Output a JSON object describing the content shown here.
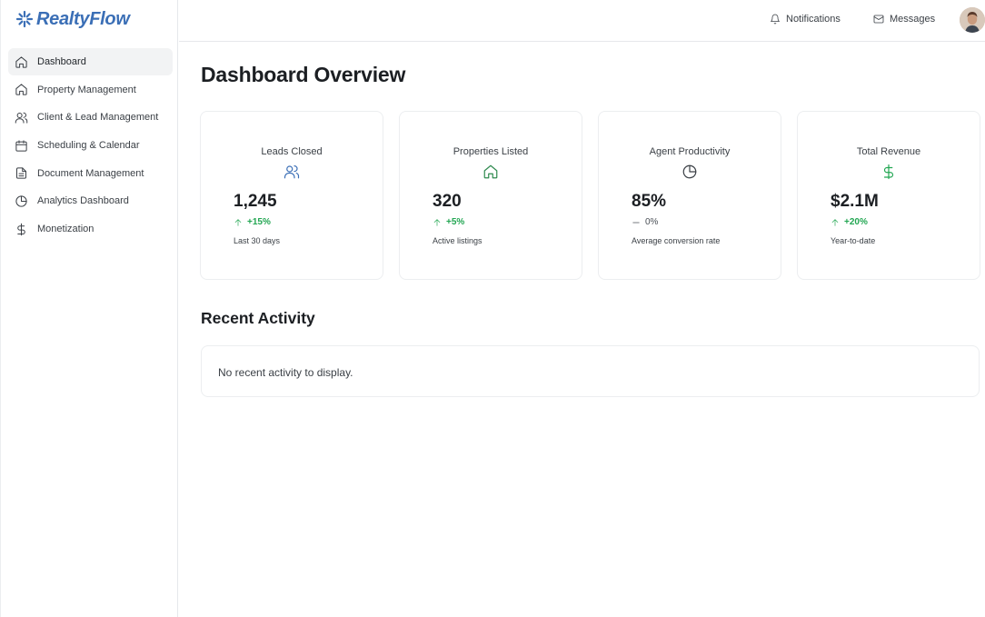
{
  "brand": {
    "name": "RealtyFlow",
    "color": "#3b6fb6"
  },
  "sidebar": {
    "items": [
      {
        "label": "Dashboard",
        "icon": "home-icon",
        "active": true
      },
      {
        "label": "Property Management",
        "icon": "home-icon"
      },
      {
        "label": "Client & Lead Management",
        "icon": "users-icon"
      },
      {
        "label": "Scheduling & Calendar",
        "icon": "calendar-icon"
      },
      {
        "label": "Document Management",
        "icon": "document-icon"
      },
      {
        "label": "Analytics Dashboard",
        "icon": "pie-chart-icon"
      },
      {
        "label": "Monetization",
        "icon": "dollar-icon"
      }
    ]
  },
  "topbar": {
    "notifications_label": "Notifications",
    "messages_label": "Messages"
  },
  "main": {
    "title": "Dashboard Overview",
    "cards": [
      {
        "title": "Leads Closed",
        "icon": "users-icon",
        "icon_color": "#3b6fb6",
        "value": "1,245",
        "change": "+15%",
        "trend": "up",
        "note": "Last 30 days"
      },
      {
        "title": "Properties Listed",
        "icon": "home-icon",
        "icon_color": "#2f8a4f",
        "value": "320",
        "change": "+5%",
        "trend": "up",
        "note": "Active listings"
      },
      {
        "title": "Agent Productivity",
        "icon": "pie-chart-icon",
        "icon_color": "#3a3f45",
        "value": "85%",
        "change": "0%",
        "trend": "flat",
        "note": "Average conversion rate"
      },
      {
        "title": "Total Revenue",
        "icon": "dollar-icon",
        "icon_color": "#22a652",
        "value": "$2.1M",
        "change": "+20%",
        "trend": "up",
        "note": "Year-to-date"
      }
    ],
    "recent_activity": {
      "title": "Recent Activity",
      "empty_text": "No recent activity to display."
    }
  },
  "colors": {
    "positive": "#22a652",
    "neutral": "#4b5057",
    "active_nav_bg": "#f2f3f4"
  }
}
